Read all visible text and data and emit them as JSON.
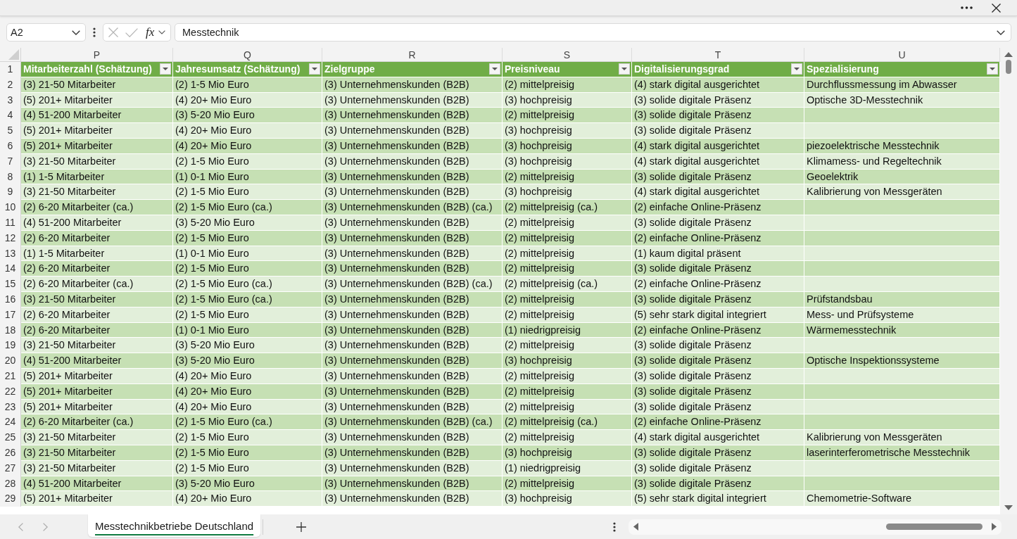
{
  "formula_bar": {
    "name_box": "A2",
    "edit_buttons_disabled": true,
    "function_label": "fx",
    "formula": "Messtechnik"
  },
  "sheet": {
    "column_letters": [
      "P",
      "Q",
      "R",
      "S",
      "T",
      "U"
    ],
    "header_row": {
      "number": "1",
      "cells": [
        "Mitarbeiterzahl (Schätzung)",
        "Jahresumsatz (Schätzung)",
        "Zielgruppe",
        "Preisniveau",
        "Digitalisierungsgrad",
        "Spezialisierung"
      ]
    },
    "rows": [
      {
        "number": "2",
        "cells": [
          "(3) 21-50 Mitarbeiter",
          "(2) 1-5 Mio Euro",
          "(3) Unternehmenskunden (B2B)",
          "(2) mittelpreisig",
          "(4) stark digital ausgerichtet",
          "Durchflussmessung im Abwasser"
        ]
      },
      {
        "number": "3",
        "cells": [
          "(5) 201+ Mitarbeiter",
          "(4) 20+ Mio Euro",
          "(3) Unternehmenskunden (B2B)",
          "(3) hochpreisig",
          "(3) solide digitale Präsenz",
          "Optische 3D-Messtechnik"
        ]
      },
      {
        "number": "4",
        "cells": [
          "(4) 51-200 Mitarbeiter",
          "(3) 5-20 Mio Euro",
          "(3) Unternehmenskunden (B2B)",
          "(2) mittelpreisig",
          "(3) solide digitale Präsenz"
        ]
      },
      {
        "number": "5",
        "cells": [
          "(5) 201+ Mitarbeiter",
          "(4) 20+ Mio Euro",
          "(3) Unternehmenskunden (B2B)",
          "(3) hochpreisig",
          "(3) solide digitale Präsenz"
        ]
      },
      {
        "number": "6",
        "cells": [
          "(5) 201+ Mitarbeiter",
          "(4) 20+ Mio Euro",
          "(3) Unternehmenskunden (B2B)",
          "(3) hochpreisig",
          "(4) stark digital ausgerichtet",
          "piezoelektrische Messtechnik"
        ]
      },
      {
        "number": "7",
        "cells": [
          "(3) 21-50 Mitarbeiter",
          "(2) 1-5 Mio Euro",
          "(3) Unternehmenskunden (B2B)",
          "(3) hochpreisig",
          "(4) stark digital ausgerichtet",
          "Klimamess- und Regeltechnik"
        ]
      },
      {
        "number": "8",
        "cells": [
          "(1) 1-5 Mitarbeiter",
          "(1) 0-1 Mio Euro",
          "(3) Unternehmenskunden (B2B)",
          "(2) mittelpreisig",
          "(3) solide digitale Präsenz",
          "Geoelektrik"
        ]
      },
      {
        "number": "9",
        "cells": [
          "(3) 21-50 Mitarbeiter",
          "(2) 1-5 Mio Euro",
          "(3) Unternehmenskunden (B2B)",
          "(3) hochpreisig",
          "(4) stark digital ausgerichtet",
          "Kalibrierung von Messgeräten"
        ]
      },
      {
        "number": "10",
        "cells": [
          "(2) 6-20 Mitarbeiter (ca.)",
          "(2) 1-5 Mio Euro (ca.)",
          "(3) Unternehmenskunden (B2B) (ca.)",
          "(2) mittelpreisig (ca.)",
          "(2) einfache Online-Präsenz"
        ]
      },
      {
        "number": "11",
        "cells": [
          "(4) 51-200 Mitarbeiter",
          "(3) 5-20 Mio Euro",
          "(3) Unternehmenskunden (B2B)",
          "(2) mittelpreisig",
          "(3) solide digitale Präsenz"
        ]
      },
      {
        "number": "12",
        "cells": [
          "(2) 6-20 Mitarbeiter",
          "(2) 1-5 Mio Euro",
          "(3) Unternehmenskunden (B2B)",
          "(2) mittelpreisig",
          "(2) einfache Online-Präsenz"
        ]
      },
      {
        "number": "13",
        "cells": [
          "(1) 1-5 Mitarbeiter",
          "(1) 0-1 Mio Euro",
          "(3) Unternehmenskunden (B2B)",
          "(2) mittelpreisig",
          "(1) kaum digital präsent"
        ]
      },
      {
        "number": "14",
        "cells": [
          "(2) 6-20 Mitarbeiter",
          "(2) 1-5 Mio Euro",
          "(3) Unternehmenskunden (B2B)",
          "(2) mittelpreisig",
          "(3) solide digitale Präsenz"
        ]
      },
      {
        "number": "15",
        "cells": [
          "(2) 6-20 Mitarbeiter (ca.)",
          "(2) 1-5 Mio Euro (ca.)",
          "(3) Unternehmenskunden (B2B) (ca.)",
          "(2) mittelpreisig (ca.)",
          "(2) einfache Online-Präsenz"
        ]
      },
      {
        "number": "16",
        "cells": [
          "(3) 21-50 Mitarbeiter",
          "(2) 1-5 Mio Euro (ca.)",
          "(3) Unternehmenskunden (B2B)",
          "(2) mittelpreisig",
          "(3) solide digitale Präsenz",
          "Prüfstandsbau"
        ]
      },
      {
        "number": "17",
        "cells": [
          "(2) 6-20 Mitarbeiter",
          "(2) 1-5 Mio Euro",
          "(3) Unternehmenskunden (B2B)",
          "(2) mittelpreisig",
          "(5) sehr stark digital integriert",
          "Mess- und Prüfsysteme"
        ]
      },
      {
        "number": "18",
        "cells": [
          "(2) 6-20 Mitarbeiter",
          "(1) 0-1 Mio Euro",
          "(3) Unternehmenskunden (B2B)",
          "(1) niedrigpreisig",
          "(2) einfache Online-Präsenz",
          "Wärmemesstechnik"
        ]
      },
      {
        "number": "19",
        "cells": [
          "(3) 21-50 Mitarbeiter",
          "(3) 5-20 Mio Euro",
          "(3) Unternehmenskunden (B2B)",
          "(2) mittelpreisig",
          "(3) solide digitale Präsenz"
        ]
      },
      {
        "number": "20",
        "cells": [
          "(4) 51-200 Mitarbeiter",
          "(3) 5-20 Mio Euro",
          "(3) Unternehmenskunden (B2B)",
          "(3) hochpreisig",
          "(3) solide digitale Präsenz",
          "Optische Inspektionssysteme"
        ]
      },
      {
        "number": "21",
        "cells": [
          "(5) 201+ Mitarbeiter",
          "(4) 20+ Mio Euro",
          "(3) Unternehmenskunden (B2B)",
          "(2) mittelpreisig",
          "(3) solide digitale Präsenz"
        ]
      },
      {
        "number": "22",
        "cells": [
          "(5) 201+ Mitarbeiter",
          "(4) 20+ Mio Euro",
          "(3) Unternehmenskunden (B2B)",
          "(2) mittelpreisig",
          "(3) solide digitale Präsenz"
        ]
      },
      {
        "number": "23",
        "cells": [
          "(5) 201+ Mitarbeiter",
          "(4) 20+ Mio Euro",
          "(3) Unternehmenskunden (B2B)",
          "(2) mittelpreisig",
          "(3) solide digitale Präsenz"
        ]
      },
      {
        "number": "24",
        "cells": [
          "(2) 6-20 Mitarbeiter (ca.)",
          "(2) 1-5 Mio Euro (ca.)",
          "(3) Unternehmenskunden (B2B) (ca.)",
          "(2) mittelpreisig (ca.)",
          "(2) einfache Online-Präsenz"
        ]
      },
      {
        "number": "25",
        "cells": [
          "(3) 21-50 Mitarbeiter",
          "(2) 1-5 Mio Euro",
          "(3) Unternehmenskunden (B2B)",
          "(2) mittelpreisig",
          "(4) stark digital ausgerichtet",
          "Kalibrierung von Messgeräten"
        ]
      },
      {
        "number": "26",
        "cells": [
          "(3) 21-50 Mitarbeiter",
          "(2) 1-5 Mio Euro",
          "(3) Unternehmenskunden (B2B)",
          "(3) hochpreisig",
          "(3) solide digitale Präsenz",
          "laserinterferometrische Messtechnik"
        ]
      },
      {
        "number": "27",
        "cells": [
          "(3) 21-50 Mitarbeiter",
          "(2) 1-5 Mio Euro",
          "(3) Unternehmenskunden (B2B)",
          "(1) niedrigpreisig",
          "(3) solide digitale Präsenz"
        ]
      },
      {
        "number": "28",
        "cells": [
          "(4) 51-200 Mitarbeiter",
          "(3) 5-20 Mio Euro",
          "(3) Unternehmenskunden (B2B)",
          "(2) mittelpreisig",
          "(3) solide digitale Präsenz"
        ]
      },
      {
        "number": "29",
        "cells": [
          "(5) 201+ Mitarbeiter",
          "(4) 20+ Mio Euro",
          "(3) Unternehmenskunden (B2B)",
          "(3) hochpreisig",
          "(5) sehr stark digital integriert",
          "Chemometrie-Software"
        ]
      }
    ]
  },
  "sheet_tabs": [
    {
      "label": "Messtechnikbetriebe Deutschland",
      "selected": true
    }
  ]
}
